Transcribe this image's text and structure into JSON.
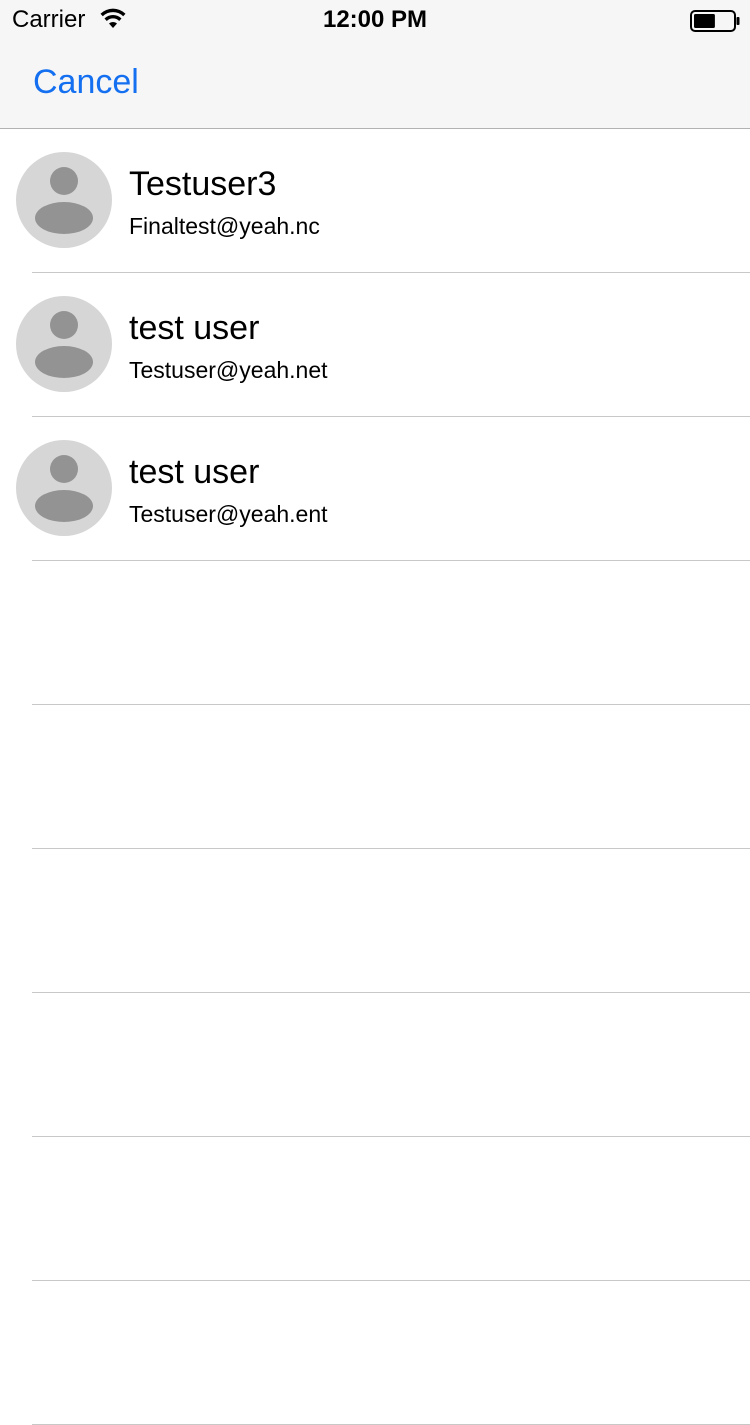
{
  "status_bar": {
    "carrier": "Carrier",
    "time": "12:00 PM",
    "battery_level": 0.55
  },
  "nav_bar": {
    "cancel_label": "Cancel",
    "accent_color": "#1470f0"
  },
  "contacts": [
    {
      "name": "Testuser3",
      "email": "Finaltest@yeah.nc",
      "avatar": "person-placeholder-icon"
    },
    {
      "name": "test user",
      "email": "Testuser@yeah.net",
      "avatar": "person-placeholder-icon"
    },
    {
      "name": "test user",
      "email": "Testuser@yeah.ent",
      "avatar": "person-placeholder-icon"
    }
  ],
  "empty_rows": 6
}
